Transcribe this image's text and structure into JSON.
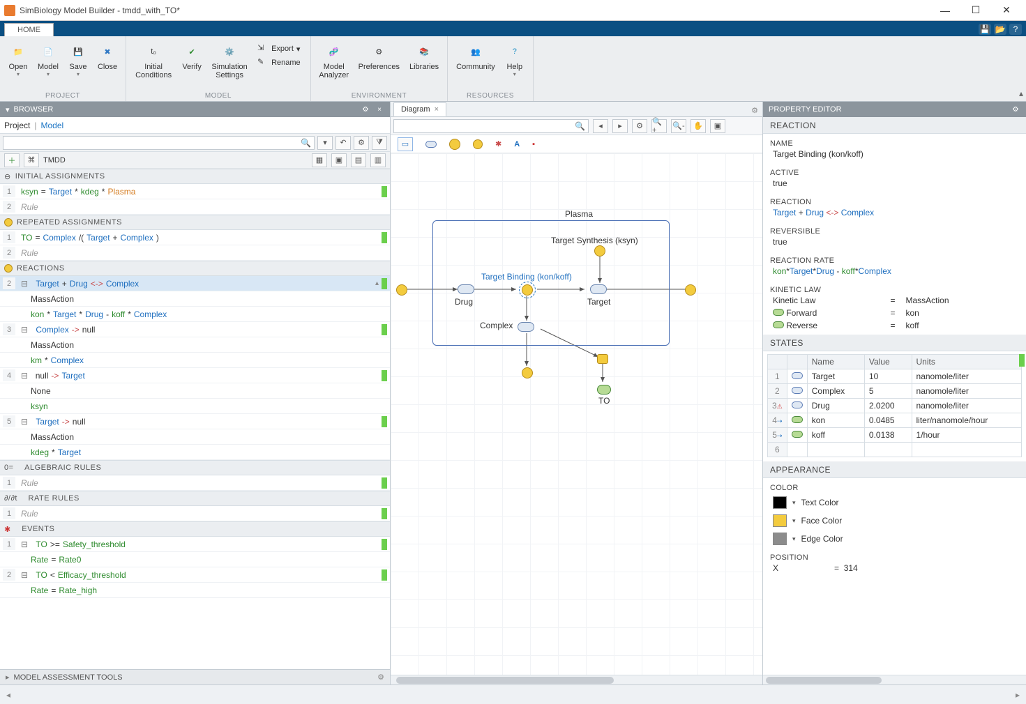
{
  "app": {
    "title": "SimBiology Model Builder - tmdd_with_TO*"
  },
  "home_tab": "HOME",
  "titlebar_icons": [
    "save-icon",
    "open-icon",
    "help-icon"
  ],
  "ribbon": {
    "groups": {
      "project": {
        "label": "PROJECT",
        "items": [
          "Open",
          "Model",
          "Save",
          "Close"
        ]
      },
      "model": {
        "label": "MODEL",
        "items": [
          "Initial Conditions",
          "Verify",
          "Simulation Settings"
        ],
        "small": [
          "Export",
          "Rename"
        ]
      },
      "environment": {
        "label": "ENVIRONMENT",
        "items": [
          "Model Analyzer",
          "Preferences",
          "Libraries"
        ]
      },
      "resources": {
        "label": "RESOURCES",
        "items": [
          "Community",
          "Help"
        ]
      }
    }
  },
  "browser": {
    "title": "BROWSER",
    "breadcrumb": {
      "root": "Project",
      "model": "Model"
    },
    "model_name": "TMDD",
    "sections": {
      "initial_assignments": {
        "label": "INITIAL ASSIGNMENTS",
        "rows": [
          {
            "n": "1",
            "raw": "ksyn = Target*kdeg*Plasma"
          },
          {
            "n": "2",
            "raw": "Rule",
            "italic": true
          }
        ]
      },
      "repeated_assignments": {
        "label": "REPEATED ASSIGNMENTS",
        "rows": [
          {
            "n": "1",
            "raw": "TO = Complex/(Target + Complex)"
          },
          {
            "n": "2",
            "raw": "Rule",
            "italic": true
          }
        ]
      },
      "reactions": {
        "label": "REACTIONS",
        "rows": [
          {
            "n": "2",
            "sel": true,
            "head": "Target + Drug <-> Complex",
            "law": "MassAction",
            "rate": "kon*Target*Drug - koff*Complex"
          },
          {
            "n": "3",
            "head": "Complex -> null",
            "law": "MassAction",
            "rate": "km*Complex"
          },
          {
            "n": "4",
            "head": "null -> Target",
            "law": "None",
            "rate": "ksyn"
          },
          {
            "n": "5",
            "head": "Target -> null",
            "law": "MassAction",
            "rate": "kdeg*Target"
          }
        ]
      },
      "algebraic": {
        "label": "ALGEBRAIC RULES",
        "rows": [
          {
            "n": "1",
            "raw": "Rule",
            "italic": true
          }
        ]
      },
      "rate_rules": {
        "label": "RATE RULES",
        "rows": [
          {
            "n": "1",
            "raw": "Rule",
            "italic": true
          }
        ]
      },
      "events": {
        "label": "EVENTS",
        "rows": [
          {
            "n": "1",
            "head": "TO>=Safety_threshold",
            "sub": "Rate = Rate0"
          },
          {
            "n": "2",
            "head": "TO<Efficacy_threshold",
            "sub": "Rate = Rate_high"
          }
        ]
      }
    },
    "footer": "MODEL ASSESSMENT TOOLS"
  },
  "diagram": {
    "tab": "Diagram",
    "labels": {
      "compartment": "Plasma",
      "target_syn": "Target Synthesis (ksyn)",
      "binding": "Target Binding (kon/koff)",
      "drug": "Drug",
      "target": "Target",
      "complex": "Complex",
      "to": "TO"
    }
  },
  "property": {
    "title": "PROPERTY EDITOR",
    "reaction_hdr": "REACTION",
    "name_label": "NAME",
    "name_value": "Target Binding (kon/koff)",
    "active_label": "ACTIVE",
    "active_value": "true",
    "reaction_label": "REACTION",
    "reaction_value_parts": {
      "lhs1": "Target",
      "plus": "+",
      "lhs2": "Drug",
      "op": "<->",
      "rhs": "Complex"
    },
    "reversible_label": "REVERSIBLE",
    "reversible_value": "true",
    "rate_label": "REACTION RATE",
    "rate_value": "kon*Target*Drug - koff*Complex",
    "kinetic_label": "KINETIC LAW",
    "kinetic": {
      "law": "Kinetic Law",
      "law_v": "MassAction",
      "fwd": "Forward",
      "fwd_v": "kon",
      "rev": "Reverse",
      "rev_v": "koff"
    },
    "states_hdr": "STATES",
    "states_cols": {
      "name": "Name",
      "value": "Value",
      "units": "Units"
    },
    "states": [
      {
        "n": "1",
        "ic": "blue",
        "name": "Target",
        "value": "10",
        "units": "nanomole/liter"
      },
      {
        "n": "2",
        "ic": "blue",
        "name": "Complex",
        "value": "5",
        "units": "nanomole/liter"
      },
      {
        "n": "3",
        "ic": "blue",
        "name": "Drug",
        "value": "2.0200",
        "units": "nanomole/liter",
        "flag": "warn"
      },
      {
        "n": "4",
        "ic": "green",
        "name": "kon",
        "value": "0.0485",
        "units": "liter/nanomole/hour",
        "flag": "info"
      },
      {
        "n": "5",
        "ic": "green",
        "name": "koff",
        "value": "0.0138",
        "units": "1/hour",
        "flag": "info"
      },
      {
        "n": "6",
        "ic": "",
        "name": "",
        "value": "",
        "units": ""
      }
    ],
    "appearance_hdr": "APPEARANCE",
    "color_label": "COLOR",
    "colors": [
      {
        "name": "Text Color",
        "hex": "#000000"
      },
      {
        "name": "Face Color",
        "hex": "#f3cb3e"
      },
      {
        "name": "Edge Color",
        "hex": "#8c8c8c"
      }
    ],
    "position_label": "POSITION",
    "position": {
      "axis": "X",
      "eq": "=",
      "val": "314"
    }
  }
}
